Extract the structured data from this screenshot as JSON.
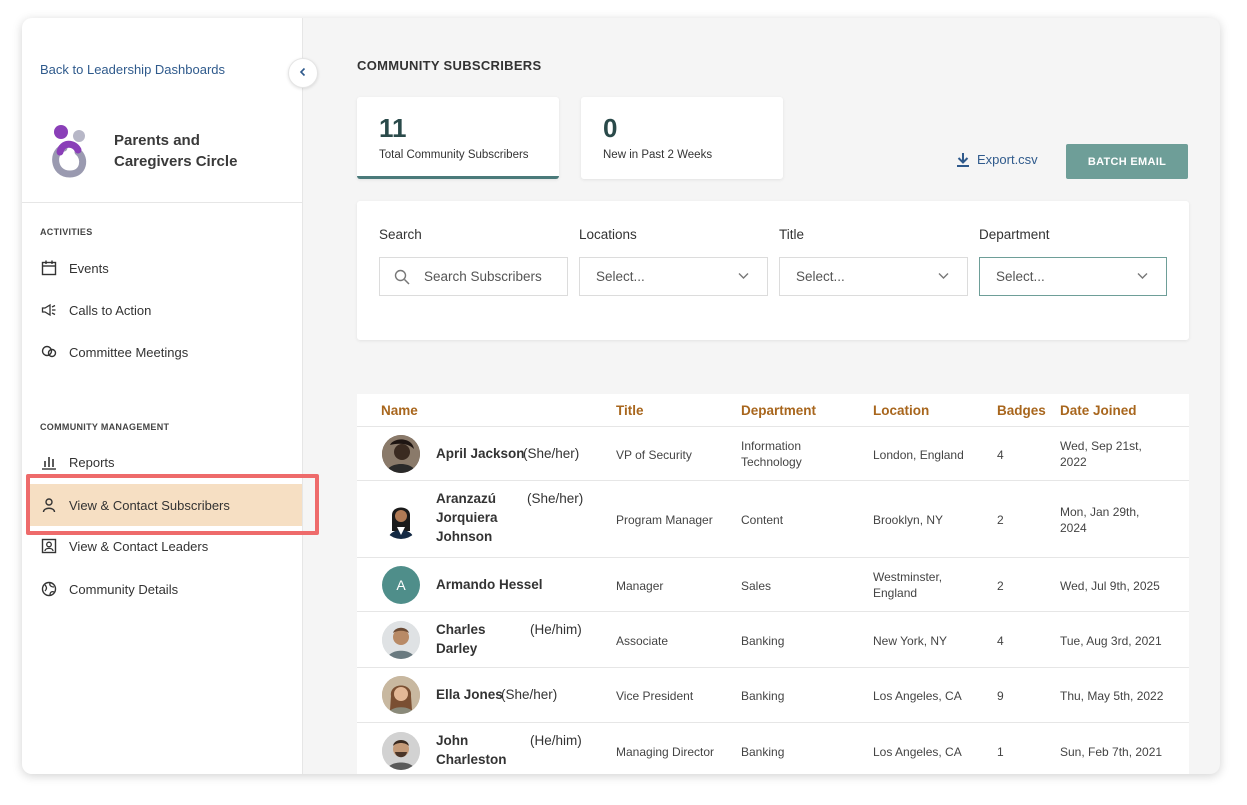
{
  "sidebar": {
    "back_link": "Back to Leadership Dashboards",
    "brand_line1": "Parents and",
    "brand_line2": "Caregivers Circle",
    "activities_label": "ACTIVITIES",
    "activities": [
      {
        "label": "Events",
        "icon": "calendar-icon"
      },
      {
        "label": "Calls to Action",
        "icon": "megaphone-icon"
      },
      {
        "label": "Committee Meetings",
        "icon": "meeting-icon"
      }
    ],
    "management_label": "COMMUNITY MANAGEMENT",
    "management": [
      {
        "label": "Reports",
        "icon": "bar-chart-icon"
      },
      {
        "label": "View & Contact Subscribers",
        "icon": "person-icon",
        "active": true
      },
      {
        "label": "View & Contact Leaders",
        "icon": "contact-card-icon"
      },
      {
        "label": "Community Details",
        "icon": "globe-icon"
      }
    ]
  },
  "main": {
    "title": "COMMUNITY SUBSCRIBERS",
    "stats": [
      {
        "value": "11",
        "label": "Total Community Subscribers"
      },
      {
        "value": "0",
        "label": "New in Past 2 Weeks"
      }
    ],
    "export_label": "Export.csv",
    "batch_email_label": "BATCH EMAIL"
  },
  "filters": {
    "search_label": "Search",
    "search_placeholder": "Search Subscribers",
    "locations_label": "Locations",
    "locations_value": "Select...",
    "title_label": "Title",
    "title_value": "Select...",
    "department_label": "Department",
    "department_value": "Select..."
  },
  "table": {
    "headers": {
      "name": "Name",
      "title": "Title",
      "department": "Department",
      "location": "Location",
      "badges": "Badges",
      "date_joined": "Date Joined"
    },
    "rows": [
      {
        "name": "April Jackson",
        "pronouns": "(She/her)",
        "title": "VP of Security",
        "department": "Information Technology",
        "location": "London, England",
        "badges": "4",
        "date": "Wed, Sep 21st, 2022"
      },
      {
        "name": "Aranzazú Jorquiera Johnson",
        "pronouns": "(She/her)",
        "title": "Program Manager",
        "department": "Content",
        "location": "Brooklyn, NY",
        "badges": "2",
        "date": "Mon, Jan 29th, 2024"
      },
      {
        "name": "Armando Hessel",
        "pronouns": "",
        "initial": "A",
        "title": "Manager",
        "department": "Sales",
        "location": "Westminster, England",
        "badges": "2",
        "date": "Wed, Jul 9th, 2025"
      },
      {
        "name": "Charles Darley",
        "pronouns": "(He/him)",
        "title": "Associate",
        "department": "Banking",
        "location": "New York, NY",
        "badges": "4",
        "date": "Tue, Aug 3rd, 2021"
      },
      {
        "name": "Ella Jones",
        "pronouns": "(She/her)",
        "title": "Vice President",
        "department": "Banking",
        "location": "Los Angeles, CA",
        "badges": "9",
        "date": "Thu, May 5th, 2022"
      },
      {
        "name": "John Charleston",
        "pronouns": "(He/him)",
        "title": "Managing Director",
        "department": "Banking",
        "location": "Los Angeles, CA",
        "badges": "1",
        "date": "Sun, Feb 7th, 2021"
      }
    ]
  },
  "colors": {
    "accent": "#6e9e98",
    "header_text": "#a8661d",
    "active_nav": "#f6dfc3",
    "highlight": "#ee6b6b",
    "link": "#2f5a8c"
  }
}
